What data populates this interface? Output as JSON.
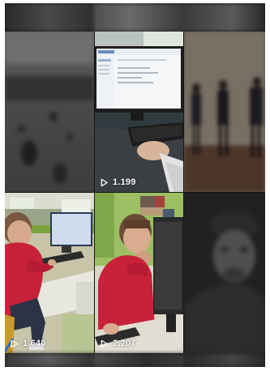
{
  "tiles": [
    {
      "id": "screen-hand",
      "views": "1.199",
      "accent": "#c9c9c9"
    },
    {
      "id": "boy-computer-room",
      "views": "1.640",
      "accent": "#c8213a"
    },
    {
      "id": "boy-thinking",
      "views": "2.207",
      "accent": "#c8213a"
    }
  ],
  "icons": {
    "play": "play-icon"
  }
}
